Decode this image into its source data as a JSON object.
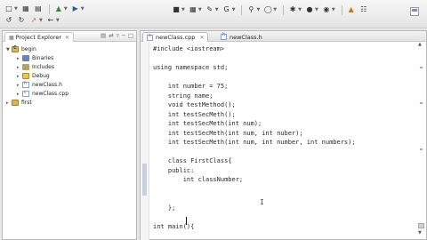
{
  "toolbar": {
    "icons": [
      "new-icon",
      "save-icon",
      "print-icon",
      "debug-icon",
      "run-icon",
      "back-icon",
      "forward-icon",
      "build-icon",
      "search-icon",
      "refactor-icon",
      "external-tools-icon",
      "run-menu-icon",
      "coverage-icon",
      "perspective-icon",
      "open-perspective-icon"
    ]
  },
  "project_explorer": {
    "title": "Project Explorer",
    "tree": [
      {
        "label": "begin",
        "type": "project",
        "expanded": true
      },
      {
        "label": "Binaries",
        "type": "binaries"
      },
      {
        "label": "Includes",
        "type": "includes"
      },
      {
        "label": "Debug",
        "type": "folder"
      },
      {
        "label": "newClass.h",
        "type": "header"
      },
      {
        "label": "newClass.cpp",
        "type": "source"
      },
      {
        "label": "first",
        "type": "project",
        "expanded": false
      }
    ]
  },
  "editor": {
    "tabs": [
      {
        "label": "newClass.cpp",
        "active": true
      },
      {
        "label": "newClass.h",
        "active": false
      }
    ],
    "lines": [
      "#include <iostream>",
      "",
      "using namespace std;",
      "",
      "    int number = 75;",
      "    string name;",
      "    void testMethod();",
      "    int testSecMeth();",
      "    int testSecMeth(int num);",
      "    int testSecMeth(int num, int nuber);",
      "    int testSecMeth(int num, int number, int numbers);",
      "",
      "    class FirstClass{",
      "    public:",
      "        int classNumber;",
      "",
      "",
      "    };",
      "",
      "int main(){",
      ""
    ]
  }
}
